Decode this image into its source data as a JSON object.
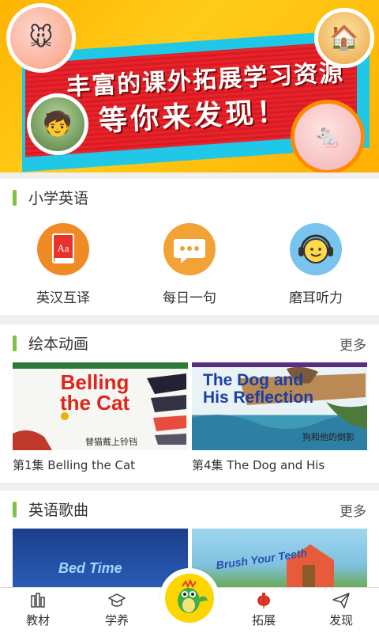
{
  "banner": {
    "line1": "丰富的课外拓展学习资源",
    "line2": "等你来发现！"
  },
  "sections": {
    "primary_english": {
      "title": "小学英语",
      "items": [
        {
          "label": "英汉互译",
          "icon": "dictionary-icon",
          "color": "#f08a24"
        },
        {
          "label": "每日一句",
          "icon": "chat-bubble-icon",
          "color": "#f3a236"
        },
        {
          "label": "磨耳听力",
          "icon": "headphones-icon",
          "color": "#79c3ef"
        }
      ]
    },
    "picture_books": {
      "title": "绘本动画",
      "more": "更多",
      "cards": [
        {
          "thumb_title": "Belling the Cat",
          "thumb_subtitle": "替猫戴上铃铛",
          "caption": "第1集  Belling the Cat"
        },
        {
          "thumb_title": "The Dog and His Reflection",
          "thumb_subtitle": "狗和他的倒影",
          "caption": "第4集  The Dog and His"
        }
      ]
    },
    "english_songs": {
      "title": "英语歌曲",
      "more": "更多",
      "cards": [
        {
          "thumb_title": "Bed Time"
        },
        {
          "thumb_title": "Brush Your Teeth"
        }
      ]
    }
  },
  "nav": {
    "items": [
      {
        "label": "教材",
        "icon": "textbook-icon"
      },
      {
        "label": "学养",
        "icon": "graduation-cap-icon"
      },
      {
        "label": "拓展",
        "icon": "lantern-icon",
        "active": true
      },
      {
        "label": "发现",
        "icon": "paper-plane-icon"
      }
    ],
    "center_icon": "dragon-mascot-icon"
  },
  "colors": {
    "accent_green": "#7dc242",
    "banner_red": "#e8232b",
    "banner_blue": "#1ec8e6",
    "active_red": "#e23a2e"
  }
}
